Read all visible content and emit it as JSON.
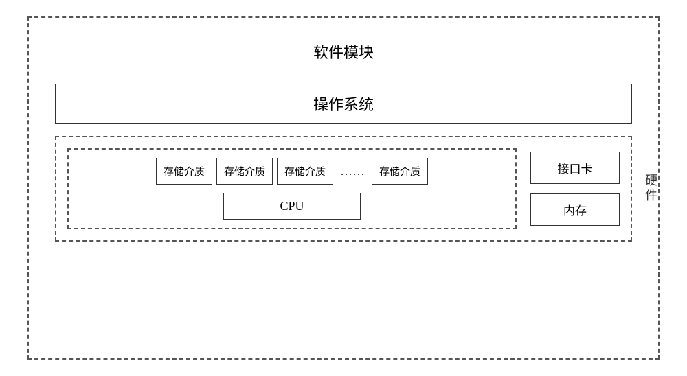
{
  "diagram": {
    "outer_border": "dashed",
    "software_label": "软件模块",
    "os_label": "操作系统",
    "hardware_section": {
      "label": "硬件",
      "storage_items": [
        "存储介质",
        "存储介质",
        "存储介质",
        "存储介质"
      ],
      "dots": "……",
      "cpu_label": "CPU",
      "interface_card_label": "接口卡",
      "memory_label": "内存"
    }
  }
}
